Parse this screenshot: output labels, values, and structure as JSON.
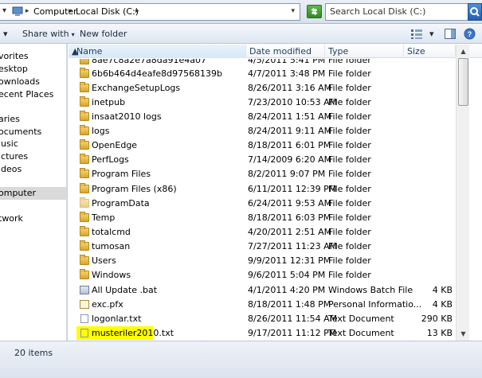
{
  "address": {
    "crumbs": [
      "Computer",
      "Local Disk (C:)"
    ],
    "search_placeholder": "Search Local Disk (C:)"
  },
  "toolbar": {
    "share_with": "Share with",
    "new_folder": "New folder"
  },
  "nav": {
    "items": [
      {
        "label": "vorites",
        "selected": false
      },
      {
        "label": "esktop",
        "selected": false
      },
      {
        "label": "ownloads",
        "selected": false
      },
      {
        "label": "ecent Places",
        "selected": false
      },
      {
        "label": "aries",
        "selected": false
      },
      {
        "label": "ocuments",
        "selected": false
      },
      {
        "label": "lusic",
        "selected": false
      },
      {
        "label": "ictures",
        "selected": false
      },
      {
        "label": "ideos",
        "selected": false
      },
      {
        "label": "omputer",
        "selected": true
      },
      {
        "label": "twork",
        "selected": false
      }
    ]
  },
  "columns": {
    "name": "Name",
    "date": "Date modified",
    "type": "Type",
    "size": "Size"
  },
  "files": [
    {
      "name": "8ae7c8a2e7a8da91e4a07",
      "date": "4/5/2011 5:41 PM",
      "type": "File folder",
      "size": "",
      "icon": "folder"
    },
    {
      "name": "6b6b464d4eafe8d97568139b",
      "date": "4/7/2011 3:48 PM",
      "type": "File folder",
      "size": "",
      "icon": "folder"
    },
    {
      "name": "ExchangeSetupLogs",
      "date": "8/26/2011 3:16 AM",
      "type": "File folder",
      "size": "",
      "icon": "folder"
    },
    {
      "name": "inetpub",
      "date": "7/23/2010 10:53 AM",
      "type": "File folder",
      "size": "",
      "icon": "folder"
    },
    {
      "name": "insaat2010 logs",
      "date": "8/24/2011 1:51 AM",
      "type": "File folder",
      "size": "",
      "icon": "folder"
    },
    {
      "name": "logs",
      "date": "8/24/2011 9:11 AM",
      "type": "File folder",
      "size": "",
      "icon": "folder"
    },
    {
      "name": "OpenEdge",
      "date": "8/18/2011 6:01 PM",
      "type": "File folder",
      "size": "",
      "icon": "folder"
    },
    {
      "name": "PerfLogs",
      "date": "7/14/2009 6:20 AM",
      "type": "File folder",
      "size": "",
      "icon": "folder"
    },
    {
      "name": "Program Files",
      "date": "8/2/2011 9:07 PM",
      "type": "File folder",
      "size": "",
      "icon": "folder"
    },
    {
      "name": "Program Files (x86)",
      "date": "6/11/2011 12:39 PM",
      "type": "File folder",
      "size": "",
      "icon": "folder"
    },
    {
      "name": "ProgramData",
      "date": "6/24/2011 9:53 AM",
      "type": "File folder",
      "size": "",
      "icon": "folder"
    },
    {
      "name": "Temp",
      "date": "8/18/2011 6:03 PM",
      "type": "File folder",
      "size": "",
      "icon": "folder"
    },
    {
      "name": "totalcmd",
      "date": "4/20/2011 2:51 AM",
      "type": "File folder",
      "size": "",
      "icon": "folder"
    },
    {
      "name": "tumosan",
      "date": "7/27/2011 11:23 AM",
      "type": "File folder",
      "size": "",
      "icon": "folder"
    },
    {
      "name": "Users",
      "date": "9/9/2011 12:31 PM",
      "type": "File folder",
      "size": "",
      "icon": "folder"
    },
    {
      "name": "Windows",
      "date": "9/6/2011 5:04 PM",
      "type": "File folder",
      "size": "",
      "icon": "folder"
    },
    {
      "name": "All Update .bat",
      "date": "4/1/2011 4:20 PM",
      "type": "Windows Batch File",
      "size": "4 KB",
      "icon": "bat"
    },
    {
      "name": "exc.pfx",
      "date": "8/18/2011 1:48 PM",
      "type": "Personal Informatio...",
      "size": "4 KB",
      "icon": "pfx"
    },
    {
      "name": "logonlar.txt",
      "date": "8/26/2011 11:54 AM",
      "type": "Text Document",
      "size": "290 KB",
      "icon": "txt"
    },
    {
      "name": "musteriler2010.txt",
      "date": "9/17/2011 11:12 PM",
      "type": "Text Document",
      "size": "13 KB",
      "icon": "txt",
      "highlighted": true
    }
  ],
  "status": {
    "item_count": "20 items"
  }
}
